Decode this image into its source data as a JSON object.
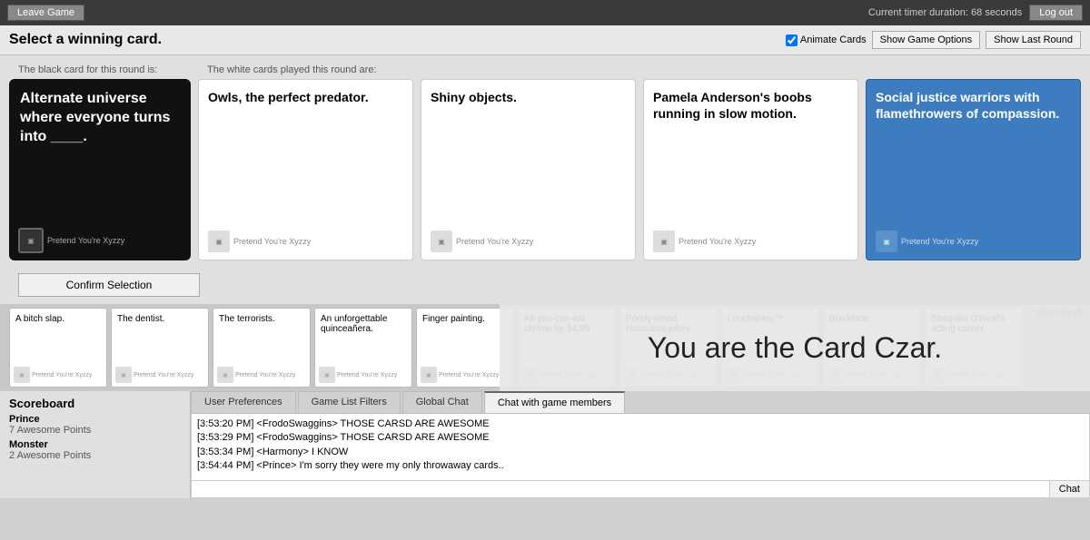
{
  "topbar": {
    "leave_label": "Leave Game",
    "timer_text": "Current timer duration: 68 seconds",
    "logout_label": "Log out"
  },
  "header": {
    "title": "Select a winning card.",
    "animate_label": "Animate Cards",
    "show_options_label": "Show Game Options",
    "show_last_round_label": "Show Last Round"
  },
  "black_card": {
    "text": "Alternate universe where everyone turns into ____.",
    "footer_logo": "●●",
    "footer_text": "Pretend You're Xyzzy"
  },
  "white_card_section_label": "The white cards played this round are:",
  "black_card_section_label": "The black card for this round is:",
  "white_cards": [
    {
      "id": 0,
      "text": "Owls, the perfect predator.",
      "footer_text": "Pretend You're Xyzzy",
      "selected": false
    },
    {
      "id": 1,
      "text": "Shiny objects.",
      "footer_text": "Pretend You're Xyzzy",
      "selected": false
    },
    {
      "id": 2,
      "text": "Pamela Anderson's boobs running in slow motion.",
      "footer_text": "Pretend You're Xyzzy",
      "selected": false
    },
    {
      "id": 3,
      "text": "Social justice warriors with flamethrowers of compassion.",
      "footer_text": "Pretend You're Xyzzy",
      "selected": true
    }
  ],
  "confirm_label": "Confirm Selection",
  "hand_label": "Your Hand",
  "hand_cards": [
    {
      "text": "A bitch slap.",
      "footer_text": "Pretend You're Xyzzy"
    },
    {
      "text": "The dentist.",
      "footer_text": "Pretend You're Xyzzy"
    },
    {
      "text": "The terrorists.",
      "footer_text": "Pretend You're Xyzzy"
    },
    {
      "text": "An unforgettable quinceañera.",
      "footer_text": "Pretend You're Xyzzy"
    },
    {
      "text": "Finger painting.",
      "footer_text": "Pretend You're Xyzzy"
    },
    {
      "text": "All-you-can-eat shrimp for $4.99",
      "footer_text": "Pretend You're Xyzzy"
    },
    {
      "text": "Poorly-timed Holocaust jokes.",
      "footer_text": "Pretend You're Xyzzy"
    },
    {
      "text": "Lunchables™.",
      "footer_text": "Pretend You're Xyzzy"
    },
    {
      "text": "Blackface.",
      "footer_text": "Pretend You're Xyzzy"
    },
    {
      "text": "Shaquille O'Neal's acting career.",
      "footer_text": "Pretend You're Xyzzy"
    }
  ],
  "czar_text": "You are the Card Czar.",
  "scoreboard": {
    "title": "Scoreboard",
    "players": [
      {
        "name": "Prince",
        "points": "7 Awesome Points"
      },
      {
        "name": "Monster",
        "points": "2 Awesome Points"
      }
    ]
  },
  "chat": {
    "tabs": [
      {
        "id": "user-prefs",
        "label": "User Preferences",
        "active": false
      },
      {
        "id": "game-filters",
        "label": "Game List Filters",
        "active": false
      },
      {
        "id": "global-chat",
        "label": "Global Chat",
        "active": false
      },
      {
        "id": "game-chat",
        "label": "Chat with game members",
        "active": true
      }
    ],
    "messages": [
      {
        "text": "[3:53:20 PM] <FrodoSwaggins> THOSE CARSD ARE AWESOME"
      },
      {
        "text": "[3:53:29 PM] <FrodoSwaggins> THOSE CARSD ARE AWESOME"
      },
      {
        "text": "[3:53:34 PM] <Harmony> I KNOW"
      },
      {
        "text": "[3:54:44 PM] <Prince> I'm sorry they were my only throwaway cards.."
      }
    ],
    "input_placeholder": "",
    "send_label": "Chat"
  }
}
